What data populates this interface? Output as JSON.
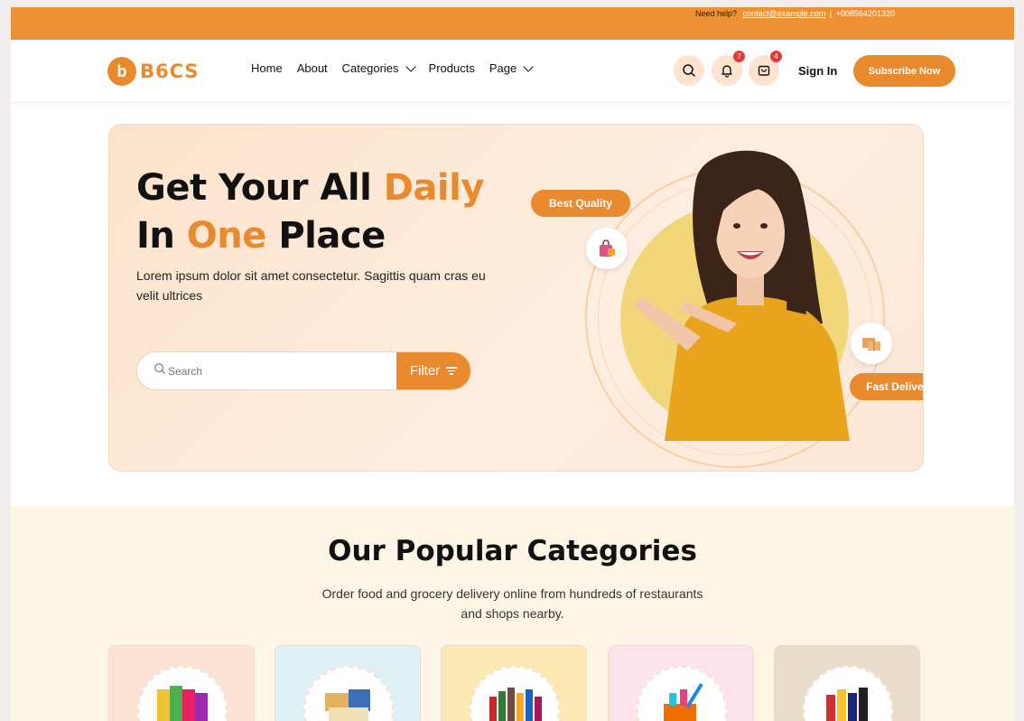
{
  "topbar": {
    "help_label": "Need help?",
    "email": "contact@example.com",
    "separator": "|",
    "phone": "+008564201320"
  },
  "header": {
    "logo_letter": "b",
    "logo_text": "B6CS",
    "nav": [
      {
        "label": "Home"
      },
      {
        "label": "About"
      },
      {
        "label": "Categories"
      },
      {
        "label": "Products"
      },
      {
        "label": "Page"
      }
    ],
    "notifications_count": "7",
    "cart_count": "4",
    "signin_label": "Sign In",
    "subscribe_label": "Subscribe Now"
  },
  "hero": {
    "title_line1_a": "Get Your All ",
    "title_line1_b": "Daily",
    "title_line2_a": "In ",
    "title_line2_b": "One",
    "title_line2_c": " Place",
    "description": "Lorem ipsum dolor sit amet consectetur. Sagittis quam cras eu velit ultrices",
    "search_placeholder": "Search",
    "filter_label": "Filter",
    "badge_quality": "Best Quality",
    "badge_delivery": "Fast Delivery"
  },
  "categories": {
    "title": "Our Popular Categories",
    "subtitle": "Order food and grocery delivery online from hundreds of restaurants and shops nearby."
  },
  "colors": {
    "accent": "#ea8a2e",
    "topbar": "#ee9134",
    "hero_bg": "#fde3cc",
    "badge_red": "#e23b3b"
  }
}
